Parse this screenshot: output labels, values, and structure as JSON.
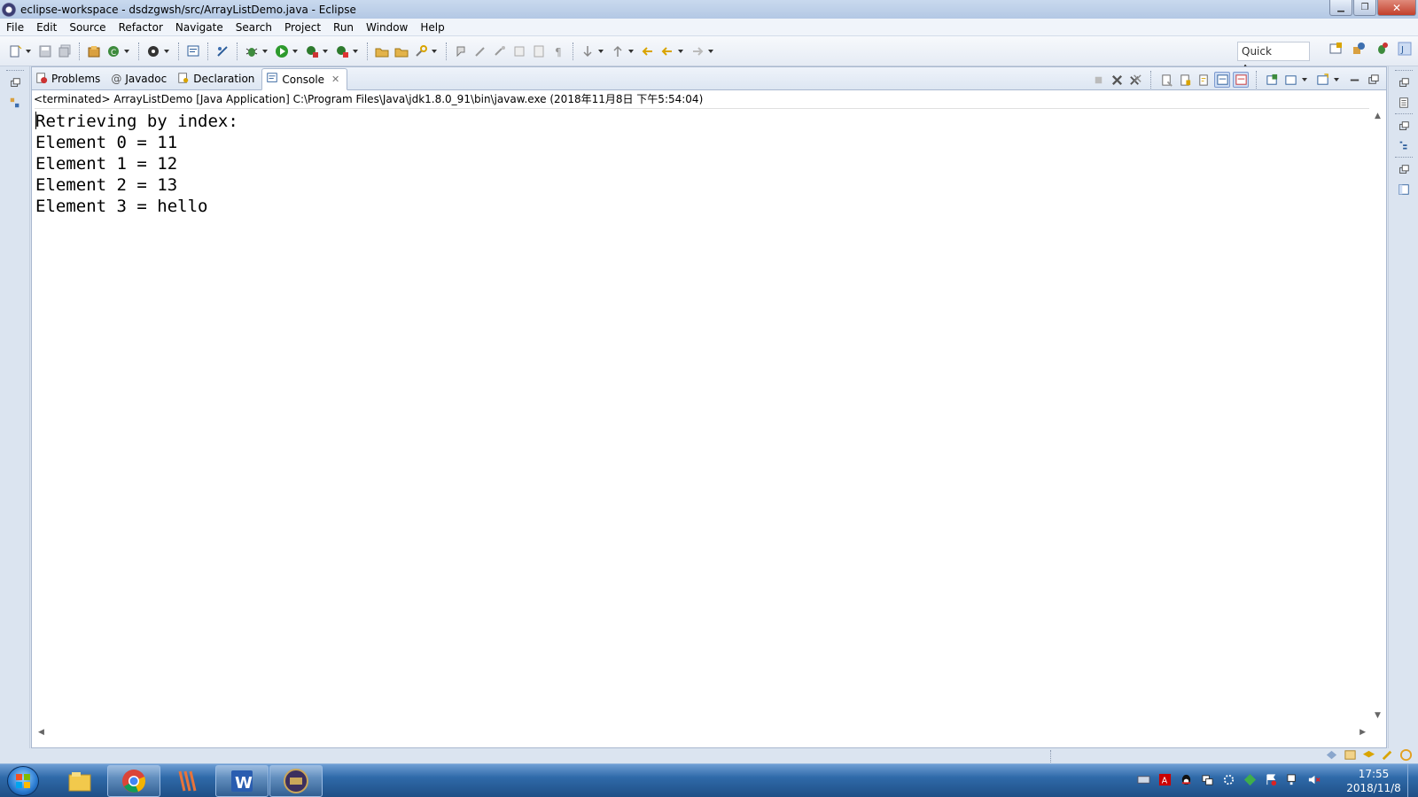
{
  "window": {
    "title": "eclipse-workspace - dsdzgwsh/src/ArrayListDemo.java - Eclipse",
    "controls": {
      "minimize": "▁",
      "restore": "❐",
      "close": "✕"
    }
  },
  "menu": [
    "File",
    "Edit",
    "Source",
    "Refactor",
    "Navigate",
    "Search",
    "Project",
    "Run",
    "Window",
    "Help"
  ],
  "toolbar": {
    "quick_access": "Quick Access"
  },
  "tabs": [
    {
      "label": "Problems",
      "icon": "problems-icon"
    },
    {
      "label": "Javadoc",
      "icon": "javadoc-icon",
      "prefix": "@"
    },
    {
      "label": "Declaration",
      "icon": "declaration-icon"
    },
    {
      "label": "Console",
      "icon": "console-icon",
      "active": true,
      "close": "✕"
    }
  ],
  "console": {
    "status": "<terminated> ArrayListDemo [Java Application] C:\\Program Files\\Java\\jdk1.8.0_91\\bin\\javaw.exe (2018年11月8日 下午5:54:04)",
    "lines": [
      "Retrieving by index:",
      "Element 0 = 11",
      "Element 1 = 12",
      "Element 2 = 13",
      "Element 3 = hello"
    ]
  },
  "scroll": {
    "up": "▲",
    "down": "▼",
    "left": "◀",
    "right": "▶"
  },
  "taskbar": {
    "clock_time": "17:55",
    "clock_date": "2018/11/8",
    "apps": [
      "file-explorer",
      "chrome",
      "app-stripes",
      "wps-writer",
      "eclipse-javaee"
    ]
  },
  "colors": {
    "accent": "#2f6aa9",
    "run_green": "#2d9a2d",
    "debug_green": "#3d8b3d"
  }
}
